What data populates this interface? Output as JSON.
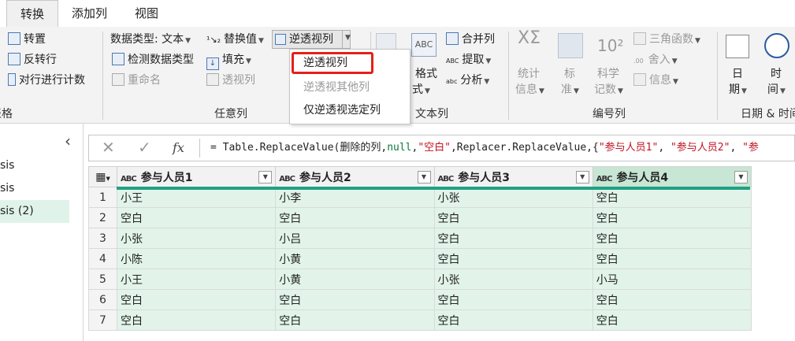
{
  "tabs": [
    {
      "label": "转换",
      "active": true
    },
    {
      "label": "添加列"
    },
    {
      "label": "视图"
    }
  ],
  "ribbon": {
    "table_group": {
      "items": [
        "转置",
        "反转行",
        "对行进行计数"
      ],
      "group_label": "表格"
    },
    "any_column": {
      "data_type": "数据类型: 文本",
      "detect_type": "检测数据类型",
      "rename": "重命名",
      "replace_values": "替换值",
      "fill": "填充",
      "pivot": "透视列",
      "unpivot": "逆透视列",
      "group_label": "任意列"
    },
    "text_column": {
      "format": "格式",
      "merge": "合并列",
      "extract": "提取",
      "parse": "分析",
      "group_label": "文本列"
    },
    "number_column": {
      "stats_top": "统计",
      "stats_bottom": "信息",
      "standard_top": "标",
      "standard_bottom": "准",
      "scientific_top": "科学",
      "scientific_bottom": "记数",
      "trig": "三角函数",
      "rounding": "舍入",
      "info": "信息",
      "group_label": "编号列"
    },
    "datetime_column": {
      "date_top": "日",
      "date_bottom": "期",
      "time_top": "时",
      "time_bottom": "间",
      "group_label": "日期 & 时间"
    }
  },
  "dropdown": {
    "items": [
      {
        "label": "逆透视列",
        "disabled": false
      },
      {
        "label": "逆透视其他列",
        "disabled": true
      },
      {
        "label": "仅逆透视选定列",
        "disabled": false
      }
    ]
  },
  "queries": [
    "sis",
    "sis",
    "sis (2)"
  ],
  "formula": {
    "prefix": "fx",
    "parts": [
      {
        "t": "= Table.ReplaceValue(删除的列,",
        "c": "fk"
      },
      {
        "t": "null",
        "c": "fn"
      },
      {
        "t": ",",
        "c": "fk"
      },
      {
        "t": "\"空白\"",
        "c": "fs"
      },
      {
        "t": ",Replacer.ReplaceValue,{",
        "c": "fk"
      },
      {
        "t": "\"参与人员1\"",
        "c": "fs"
      },
      {
        "t": ", ",
        "c": "fk"
      },
      {
        "t": "\"参与人员2\"",
        "c": "fs"
      },
      {
        "t": ", ",
        "c": "fk"
      },
      {
        "t": "\"参",
        "c": "fs"
      }
    ]
  },
  "table": {
    "type_prefix": "ABC",
    "columns": [
      "参与人员1",
      "参与人员2",
      "参与人员3",
      "参与人员4"
    ],
    "rows": [
      [
        "1",
        "小王",
        "小李",
        "小张",
        "空白"
      ],
      [
        "2",
        "空白",
        "空白",
        "空白",
        "空白"
      ],
      [
        "3",
        "小张",
        "小吕",
        "空白",
        "空白"
      ],
      [
        "4",
        "小陈",
        "小黄",
        "空白",
        "空白"
      ],
      [
        "5",
        "小王",
        "小黄",
        "小张",
        "小马"
      ],
      [
        "6",
        "空白",
        "空白",
        "空白",
        "空白"
      ],
      [
        "7",
        "空白",
        "空白",
        "空白",
        "空白"
      ]
    ]
  },
  "colors": {
    "accent": "#1fa184",
    "highlight": "#e3201b",
    "selected_row": "#e2f4ea"
  }
}
